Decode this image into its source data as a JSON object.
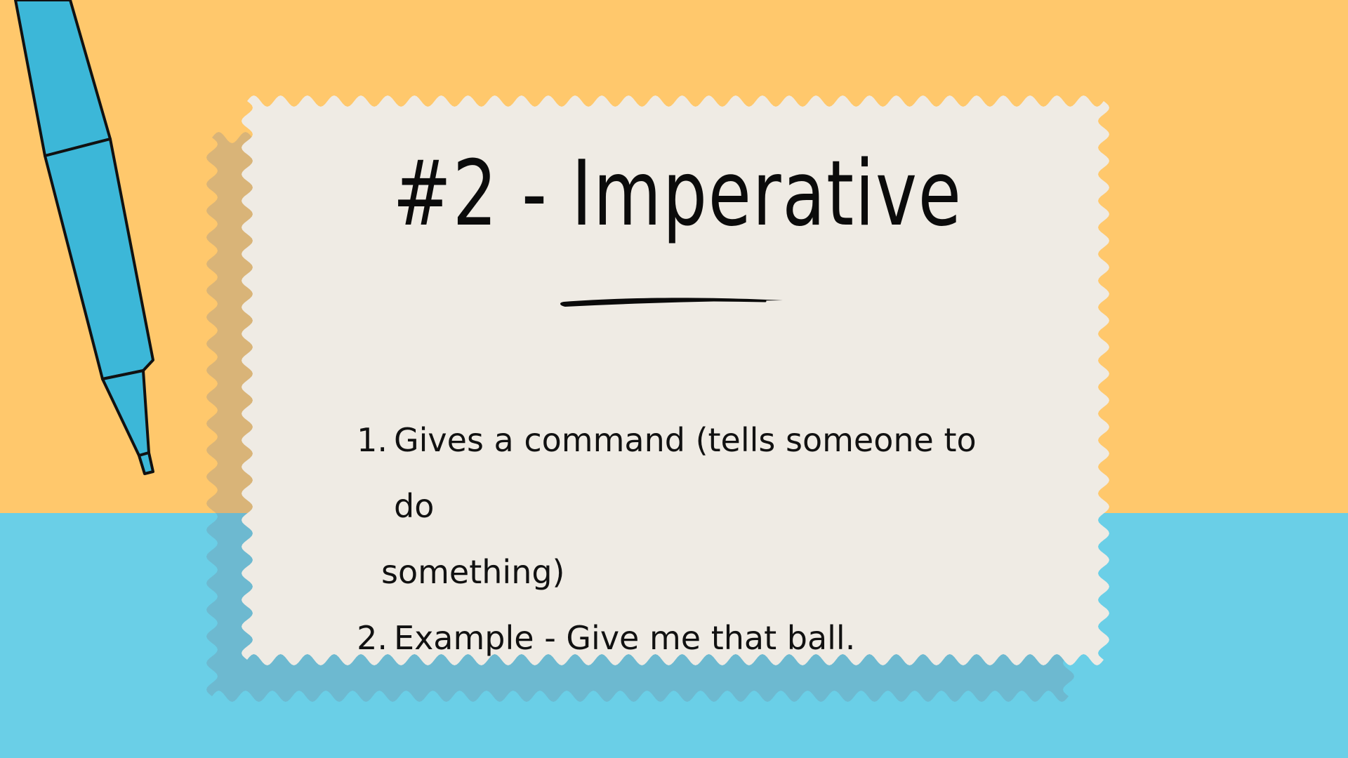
{
  "slide": {
    "title": "#2 - Imperative",
    "items": [
      {
        "number": "1.",
        "line1": "Gives a command (tells someone to do",
        "line2": "something)"
      },
      {
        "number": "2.",
        "line1": "Example - Give me that ball."
      }
    ]
  },
  "colors": {
    "background_top": "#FFC86C",
    "background_bottom": "#6ACFE7",
    "card": "#EFEBE4",
    "pen": "#3CB7D8",
    "text": "#111111"
  },
  "icons": [
    "pen-icon",
    "brush-underline"
  ]
}
